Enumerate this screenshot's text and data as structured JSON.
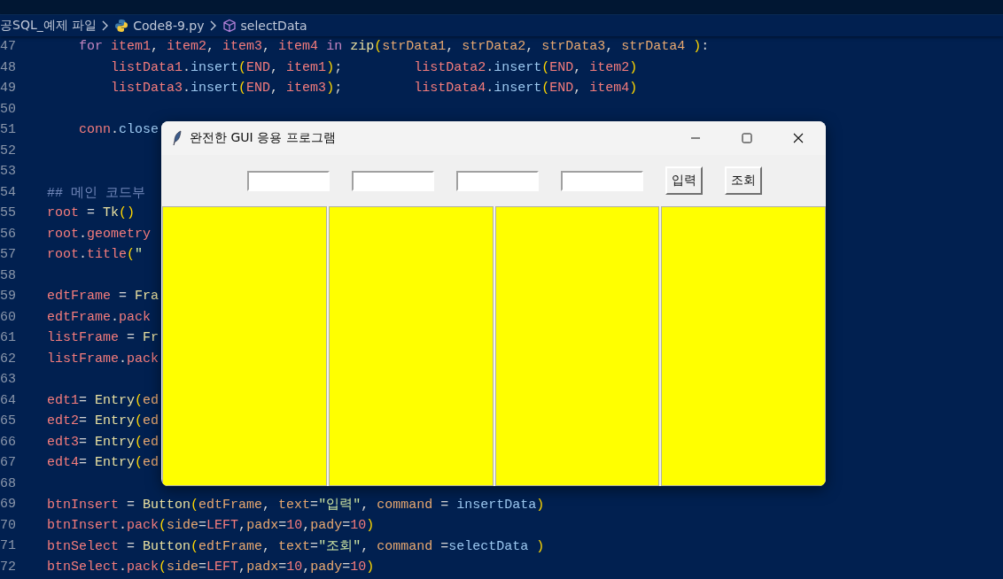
{
  "breadcrumb": [
    {
      "kind": "folder",
      "label": "공SQL_예제 파일"
    },
    {
      "kind": "python",
      "label": "Code8-9.py"
    },
    {
      "kind": "symbol",
      "label": "selectData"
    }
  ],
  "code_lines": [
    {
      "number": "47",
      "tokens": [
        {
          "kind": "kw",
          "text": "    for "
        },
        {
          "kind": "var",
          "text": "item1"
        },
        {
          "kind": "plain",
          "text": ", "
        },
        {
          "kind": "var",
          "text": "item2"
        },
        {
          "kind": "plain",
          "text": ", "
        },
        {
          "kind": "var",
          "text": "item3"
        },
        {
          "kind": "plain",
          "text": ", "
        },
        {
          "kind": "var",
          "text": "item4"
        },
        {
          "kind": "kw",
          "text": " in "
        },
        {
          "kind": "func",
          "text": "zip"
        },
        {
          "kind": "paren",
          "text": "("
        },
        {
          "kind": "arg",
          "text": "strData1"
        },
        {
          "kind": "plain",
          "text": ", "
        },
        {
          "kind": "arg",
          "text": "strData2"
        },
        {
          "kind": "plain",
          "text": ", "
        },
        {
          "kind": "arg",
          "text": "strData3"
        },
        {
          "kind": "plain",
          "text": ", "
        },
        {
          "kind": "arg",
          "text": "strData4"
        },
        {
          "kind": "paren",
          "text": " )"
        },
        {
          "kind": "plain",
          "text": ":"
        }
      ]
    },
    {
      "number": "48",
      "tokens": [
        {
          "kind": "var",
          "text": "        listData1"
        },
        {
          "kind": "plain",
          "text": "."
        },
        {
          "kind": "method",
          "text": "insert"
        },
        {
          "kind": "paren",
          "text": "("
        },
        {
          "kind": "var",
          "text": "END"
        },
        {
          "kind": "plain",
          "text": ", "
        },
        {
          "kind": "var",
          "text": "item1"
        },
        {
          "kind": "paren",
          "text": ")"
        },
        {
          "kind": "plain",
          "text": ";         "
        },
        {
          "kind": "var",
          "text": "listData2"
        },
        {
          "kind": "plain",
          "text": "."
        },
        {
          "kind": "method",
          "text": "insert"
        },
        {
          "kind": "paren",
          "text": "("
        },
        {
          "kind": "var",
          "text": "END"
        },
        {
          "kind": "plain",
          "text": ", "
        },
        {
          "kind": "var",
          "text": "item2"
        },
        {
          "kind": "paren",
          "text": ")"
        }
      ]
    },
    {
      "number": "49",
      "tokens": [
        {
          "kind": "var",
          "text": "        listData3"
        },
        {
          "kind": "plain",
          "text": "."
        },
        {
          "kind": "method",
          "text": "insert"
        },
        {
          "kind": "paren",
          "text": "("
        },
        {
          "kind": "var",
          "text": "END"
        },
        {
          "kind": "plain",
          "text": ", "
        },
        {
          "kind": "var",
          "text": "item3"
        },
        {
          "kind": "paren",
          "text": ")"
        },
        {
          "kind": "plain",
          "text": ";         "
        },
        {
          "kind": "var",
          "text": "listData4"
        },
        {
          "kind": "plain",
          "text": "."
        },
        {
          "kind": "method",
          "text": "insert"
        },
        {
          "kind": "paren",
          "text": "("
        },
        {
          "kind": "var",
          "text": "END"
        },
        {
          "kind": "plain",
          "text": ", "
        },
        {
          "kind": "var",
          "text": "item4"
        },
        {
          "kind": "paren",
          "text": ")"
        }
      ]
    },
    {
      "number": "50"
    },
    {
      "number": "51",
      "tokens": [
        {
          "kind": "var",
          "text": "    conn"
        },
        {
          "kind": "plain",
          "text": "."
        },
        {
          "kind": "method",
          "text": "close"
        }
      ]
    },
    {
      "number": "52"
    },
    {
      "number": "53"
    },
    {
      "number": "54",
      "tokens": [
        {
          "kind": "comment",
          "text": "## 메인 코드부"
        }
      ]
    },
    {
      "number": "55",
      "tokens": [
        {
          "kind": "var",
          "text": "root"
        },
        {
          "kind": "plain",
          "text": " = "
        },
        {
          "kind": "func",
          "text": "Tk"
        },
        {
          "kind": "paren",
          "text": "()"
        }
      ]
    },
    {
      "number": "56",
      "tokens": [
        {
          "kind": "var",
          "text": "root"
        },
        {
          "kind": "plain",
          "text": "."
        },
        {
          "kind": "var",
          "text": "geometry"
        }
      ]
    },
    {
      "number": "57",
      "tokens": [
        {
          "kind": "var",
          "text": "root"
        },
        {
          "kind": "plain",
          "text": "."
        },
        {
          "kind": "var",
          "text": "title"
        },
        {
          "kind": "paren",
          "text": "("
        },
        {
          "kind": "string",
          "text": "\""
        }
      ]
    },
    {
      "number": "58"
    },
    {
      "number": "59",
      "tokens": [
        {
          "kind": "var",
          "text": "edtFrame"
        },
        {
          "kind": "plain",
          "text": " = "
        },
        {
          "kind": "func",
          "text": "Fra"
        }
      ]
    },
    {
      "number": "60",
      "tokens": [
        {
          "kind": "var",
          "text": "edtFrame"
        },
        {
          "kind": "plain",
          "text": "."
        },
        {
          "kind": "var",
          "text": "pack"
        }
      ]
    },
    {
      "number": "61",
      "tokens": [
        {
          "kind": "var",
          "text": "listFrame"
        },
        {
          "kind": "plain",
          "text": " = "
        },
        {
          "kind": "func",
          "text": "Fr"
        }
      ]
    },
    {
      "number": "62",
      "tokens": [
        {
          "kind": "var",
          "text": "listFrame"
        },
        {
          "kind": "plain",
          "text": "."
        },
        {
          "kind": "var",
          "text": "pack"
        }
      ]
    },
    {
      "number": "63"
    },
    {
      "number": "64",
      "tokens": [
        {
          "kind": "var",
          "text": "edt1"
        },
        {
          "kind": "plain",
          "text": "= "
        },
        {
          "kind": "func",
          "text": "Entry"
        },
        {
          "kind": "paren",
          "text": "("
        },
        {
          "kind": "arg",
          "text": "ed"
        }
      ]
    },
    {
      "number": "65",
      "tokens": [
        {
          "kind": "var",
          "text": "edt2"
        },
        {
          "kind": "plain",
          "text": "= "
        },
        {
          "kind": "func",
          "text": "Entry"
        },
        {
          "kind": "paren",
          "text": "("
        },
        {
          "kind": "arg",
          "text": "ed"
        }
      ]
    },
    {
      "number": "66",
      "tokens": [
        {
          "kind": "var",
          "text": "edt3"
        },
        {
          "kind": "plain",
          "text": "= "
        },
        {
          "kind": "func",
          "text": "Entry"
        },
        {
          "kind": "paren",
          "text": "("
        },
        {
          "kind": "arg",
          "text": "ed"
        }
      ]
    },
    {
      "number": "67",
      "tokens": [
        {
          "kind": "var",
          "text": "edt4"
        },
        {
          "kind": "plain",
          "text": "= "
        },
        {
          "kind": "func",
          "text": "Entry"
        },
        {
          "kind": "paren",
          "text": "("
        },
        {
          "kind": "arg",
          "text": "ed"
        }
      ]
    },
    {
      "number": "68"
    },
    {
      "number": "69",
      "tokens": [
        {
          "kind": "var",
          "text": "btnInsert"
        },
        {
          "kind": "plain",
          "text": " = "
        },
        {
          "kind": "func",
          "text": "Button"
        },
        {
          "kind": "paren",
          "text": "("
        },
        {
          "kind": "arg",
          "text": "edtFrame"
        },
        {
          "kind": "plain",
          "text": ", "
        },
        {
          "kind": "arg",
          "text": "text"
        },
        {
          "kind": "plain",
          "text": "="
        },
        {
          "kind": "string",
          "text": "\"입력\""
        },
        {
          "kind": "plain",
          "text": ", "
        },
        {
          "kind": "arg",
          "text": "command"
        },
        {
          "kind": "plain",
          "text": " = "
        },
        {
          "kind": "method",
          "text": "insertData"
        },
        {
          "kind": "paren",
          "text": ")"
        }
      ]
    },
    {
      "number": "70",
      "tokens": [
        {
          "kind": "var",
          "text": "btnInsert"
        },
        {
          "kind": "plain",
          "text": "."
        },
        {
          "kind": "var",
          "text": "pack"
        },
        {
          "kind": "paren",
          "text": "("
        },
        {
          "kind": "arg",
          "text": "side"
        },
        {
          "kind": "plain",
          "text": "="
        },
        {
          "kind": "var",
          "text": "LEFT"
        },
        {
          "kind": "plain",
          "text": ","
        },
        {
          "kind": "arg",
          "text": "padx"
        },
        {
          "kind": "plain",
          "text": "="
        },
        {
          "kind": "number",
          "text": "10"
        },
        {
          "kind": "plain",
          "text": ","
        },
        {
          "kind": "arg",
          "text": "pady"
        },
        {
          "kind": "plain",
          "text": "="
        },
        {
          "kind": "number",
          "text": "10"
        },
        {
          "kind": "paren",
          "text": ")"
        }
      ]
    },
    {
      "number": "71",
      "tokens": [
        {
          "kind": "var",
          "text": "btnSelect"
        },
        {
          "kind": "plain",
          "text": " = "
        },
        {
          "kind": "func",
          "text": "Button"
        },
        {
          "kind": "paren",
          "text": "("
        },
        {
          "kind": "arg",
          "text": "edtFrame"
        },
        {
          "kind": "plain",
          "text": ", "
        },
        {
          "kind": "arg",
          "text": "text"
        },
        {
          "kind": "plain",
          "text": "="
        },
        {
          "kind": "string",
          "text": "\"조회\""
        },
        {
          "kind": "plain",
          "text": ", "
        },
        {
          "kind": "arg",
          "text": "command"
        },
        {
          "kind": "plain",
          "text": " ="
        },
        {
          "kind": "method",
          "text": "selectData"
        },
        {
          "kind": "paren",
          "text": " )"
        }
      ]
    },
    {
      "number": "72",
      "tokens": [
        {
          "kind": "var",
          "text": "btnSelect"
        },
        {
          "kind": "plain",
          "text": "."
        },
        {
          "kind": "var",
          "text": "pack"
        },
        {
          "kind": "paren",
          "text": "("
        },
        {
          "kind": "arg",
          "text": "side"
        },
        {
          "kind": "plain",
          "text": "="
        },
        {
          "kind": "var",
          "text": "LEFT"
        },
        {
          "kind": "plain",
          "text": ","
        },
        {
          "kind": "arg",
          "text": "padx"
        },
        {
          "kind": "plain",
          "text": "="
        },
        {
          "kind": "number",
          "text": "10"
        },
        {
          "kind": "plain",
          "text": ","
        },
        {
          "kind": "arg",
          "text": "pady"
        },
        {
          "kind": "plain",
          "text": "="
        },
        {
          "kind": "number",
          "text": "10"
        },
        {
          "kind": "paren",
          "text": ")"
        }
      ]
    }
  ],
  "tk_window": {
    "title": "완전한 GUI 응용 프로그램",
    "entries": [
      {
        "kind": "text"
      },
      {
        "kind": "text"
      },
      {
        "kind": "text"
      },
      {
        "kind": "text"
      }
    ],
    "buttons": [
      "입력",
      "조회"
    ],
    "listboxes": [
      {
        "color": "#ffff00"
      },
      {
        "color": "#ffff00"
      },
      {
        "color": "#ffff00"
      },
      {
        "color": "#ffff00"
      }
    ]
  }
}
